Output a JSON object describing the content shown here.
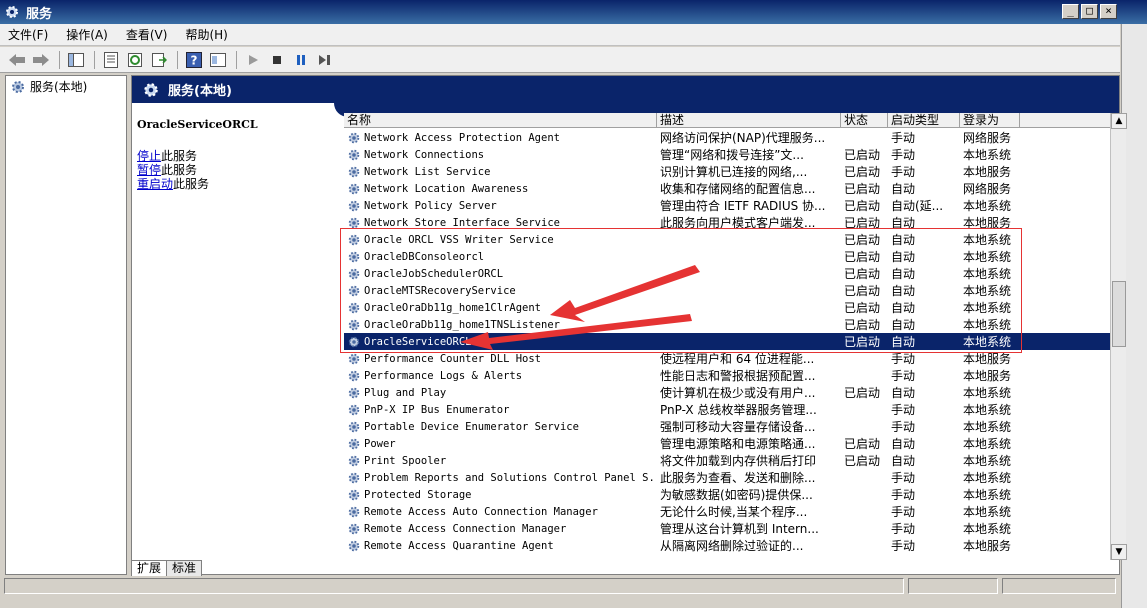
{
  "window": {
    "title": "服务"
  },
  "menu": [
    {
      "id": "file",
      "label": "文件(F)"
    },
    {
      "id": "action",
      "label": "操作(A)"
    },
    {
      "id": "view",
      "label": "查看(V)"
    },
    {
      "id": "help",
      "label": "帮助(H)"
    }
  ],
  "tree": {
    "root_label": "服务(本地)"
  },
  "header": {
    "title": "服务(本地)"
  },
  "detail": {
    "service_name": "OracleServiceORCL",
    "actions": [
      {
        "link": "停止",
        "rest": "此服务"
      },
      {
        "link": "暂停",
        "rest": "此服务"
      },
      {
        "link": "重启动",
        "rest": "此服务"
      }
    ]
  },
  "columns": {
    "name": "名称",
    "desc": "描述",
    "status": "状态",
    "startup": "启动类型",
    "logon": "登录为"
  },
  "services": [
    {
      "name": "Network Access Protection Agent",
      "desc": "网络访问保护(NAP)代理服务...",
      "status": "",
      "startup": "手动",
      "logon": "网络服务"
    },
    {
      "name": "Network Connections",
      "desc": "管理“网络和拨号连接”文...",
      "status": "已启动",
      "startup": "手动",
      "logon": "本地系统"
    },
    {
      "name": "Network List Service",
      "desc": "识别计算机已连接的网络,...",
      "status": "已启动",
      "startup": "手动",
      "logon": "本地服务"
    },
    {
      "name": "Network Location Awareness",
      "desc": "收集和存储网络的配置信息...",
      "status": "已启动",
      "startup": "自动",
      "logon": "网络服务"
    },
    {
      "name": "Network Policy Server",
      "desc": "管理由符合 IETF RADIUS 协...",
      "status": "已启动",
      "startup": "自动(延...",
      "logon": "本地系统"
    },
    {
      "name": "Network Store Interface Service",
      "desc": "此服务向用户模式客户端发...",
      "status": "已启动",
      "startup": "自动",
      "logon": "本地服务"
    },
    {
      "name": "Oracle ORCL VSS Writer Service",
      "desc": "",
      "status": "已启动",
      "startup": "自动",
      "logon": "本地系统"
    },
    {
      "name": "OracleDBConsoleorcl",
      "desc": "",
      "status": "已启动",
      "startup": "自动",
      "logon": "本地系统"
    },
    {
      "name": "OracleJobSchedulerORCL",
      "desc": "",
      "status": "已启动",
      "startup": "自动",
      "logon": "本地系统"
    },
    {
      "name": "OracleMTSRecoveryService",
      "desc": "",
      "status": "已启动",
      "startup": "自动",
      "logon": "本地系统"
    },
    {
      "name": "OracleOraDb11g_home1ClrAgent",
      "desc": "",
      "status": "已启动",
      "startup": "自动",
      "logon": "本地系统"
    },
    {
      "name": "OracleOraDb11g_home1TNSListener",
      "desc": "",
      "status": "已启动",
      "startup": "自动",
      "logon": "本地系统"
    },
    {
      "name": "OracleServiceORCL",
      "desc": "",
      "status": "已启动",
      "startup": "自动",
      "logon": "本地系统",
      "selected": true
    },
    {
      "name": "Performance Counter DLL Host",
      "desc": "使远程用户和 64 位进程能...",
      "status": "",
      "startup": "手动",
      "logon": "本地服务"
    },
    {
      "name": "Performance Logs & Alerts",
      "desc": "性能日志和警报根据预配置...",
      "status": "",
      "startup": "手动",
      "logon": "本地服务"
    },
    {
      "name": "Plug and Play",
      "desc": "使计算机在极少或没有用户...",
      "status": "已启动",
      "startup": "自动",
      "logon": "本地系统"
    },
    {
      "name": "PnP-X IP Bus Enumerator",
      "desc": "PnP-X 总线枚举器服务管理...",
      "status": "",
      "startup": "手动",
      "logon": "本地系统"
    },
    {
      "name": "Portable Device Enumerator Service",
      "desc": "强制可移动大容量存储设备...",
      "status": "",
      "startup": "手动",
      "logon": "本地系统"
    },
    {
      "name": "Power",
      "desc": "管理电源策略和电源策略通...",
      "status": "已启动",
      "startup": "自动",
      "logon": "本地系统"
    },
    {
      "name": "Print Spooler",
      "desc": "将文件加载到内存供稍后打印",
      "status": "已启动",
      "startup": "自动",
      "logon": "本地系统"
    },
    {
      "name": "Problem Reports and Solutions Control Panel S...",
      "desc": "此服务为查看、发送和删除...",
      "status": "",
      "startup": "手动",
      "logon": "本地系统"
    },
    {
      "name": "Protected Storage",
      "desc": "为敏感数据(如密码)提供保...",
      "status": "",
      "startup": "手动",
      "logon": "本地系统"
    },
    {
      "name": "Remote Access Auto Connection Manager",
      "desc": "无论什么时候,当某个程序...",
      "status": "",
      "startup": "手动",
      "logon": "本地系统"
    },
    {
      "name": "Remote Access Connection Manager",
      "desc": "管理从这台计算机到 Intern...",
      "status": "",
      "startup": "手动",
      "logon": "本地系统"
    },
    {
      "name": "Remote Access Quarantine Agent",
      "desc": "从隔离网络删除过验证的...",
      "status": "",
      "startup": "手动",
      "logon": "本地服务"
    }
  ],
  "tabs": [
    {
      "label": "扩展",
      "active": true
    },
    {
      "label": "标准",
      "active": false
    }
  ],
  "colors": {
    "selection": "#0a246a",
    "header": "#0a246a",
    "annotation": "#e53333"
  },
  "icons": [
    "gear-icon",
    "back-arrow-icon",
    "forward-arrow-icon",
    "console-tree-icon",
    "properties-icon",
    "refresh-icon",
    "export-icon",
    "help-icon",
    "view-icon",
    "start-icon",
    "stop-icon",
    "pause-icon",
    "restart-icon"
  ]
}
